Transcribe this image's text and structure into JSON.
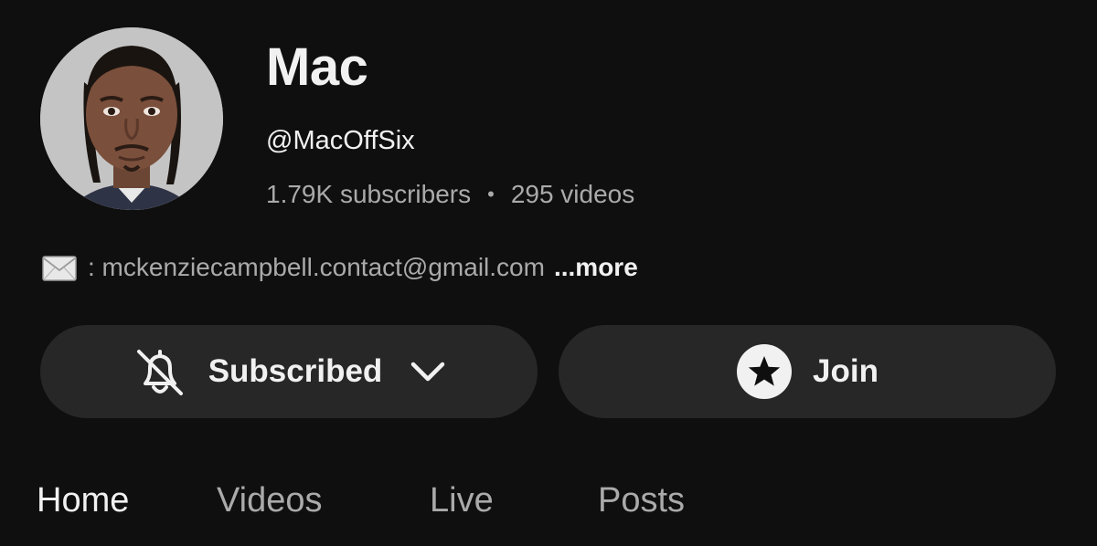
{
  "channel": {
    "name": "Mac",
    "handle": "@MacOffSix",
    "subscribers": "1.79K subscribers",
    "separator": "•",
    "videos": "295 videos"
  },
  "description": {
    "icon": "envelope-icon",
    "text": ": mckenziecampbell.contact@gmail.com",
    "more_label": "...more"
  },
  "actions": {
    "subscribe_label": "Subscribed",
    "join_label": "Join"
  },
  "tabs": [
    {
      "label": "Home",
      "active": true
    },
    {
      "label": "Videos",
      "active": false
    },
    {
      "label": "Live",
      "active": false
    },
    {
      "label": "Posts",
      "active": false
    }
  ],
  "colors": {
    "background": "#0f0f0f",
    "button_bg": "#272727",
    "text_primary": "#f1f1f1",
    "text_secondary": "#aaaaaa"
  }
}
